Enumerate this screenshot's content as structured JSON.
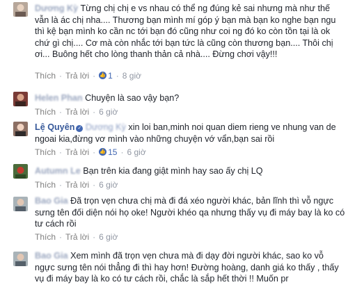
{
  "comments": [
    {
      "author": "Dương Kỳ",
      "text": "Từng chị chị e vs nhau có thể ng đúng kẻ sai nhưng mà như thế vẫn là ác chị nha.... Thương bạn mình mí góp ý bạn mà bạn ko nghe bạn ngu thì kệ bạn mình ko cần nc tới bạn đó cũng như coi ng đó ko còn tồn tại là ok chứ gì chị.... Cơ mà còn nhắc tới bạn tức là cũng còn thương bạn.... Thôi chị ơi... Buông hết cho lòng thanh thản cả nhà.... Đừng chơi vậy!!!",
      "like": "Thích",
      "reply": "Trả lời",
      "reactions": "1",
      "time": "8 giờ"
    },
    {
      "author": "Helen Phan",
      "text": "Chuyện là sao vậy bạn?",
      "like": "Thích",
      "reply": "Trả lời",
      "time": "6 giờ"
    },
    {
      "author": "Lệ Quyên",
      "mention": "Dương Kỳ",
      "text": "xin loi ban,minh noi quan diem rieng ve nhung van de ngoai kia,đừng vơ mình vào những chuyện vớ vẩn,bạn sai rồi",
      "like": "Thích",
      "reply": "Trả lời",
      "reactions": "15",
      "time": "6 giờ"
    },
    {
      "author": "Autumn Le",
      "text": "Bạn trên kia đang giật mình hay sao ấy chị LQ",
      "like": "Thích",
      "reply": "Trả lời",
      "time": "6 giờ"
    },
    {
      "author": "Bao Gia",
      "text": "Đã trọn vẹn chưa chị mà đi đá xéo người khác, bản lĩnh thì vỗ ngực sưng tên đối diện nói họ oke! Người khéo qa nhưng thấy vụ đi máy bay là ko có tư cách rồi",
      "like": "Thích",
      "reply": "Trả lời",
      "time": "6 giờ"
    },
    {
      "author": "Bao Gia",
      "text": "Xem mình đã trọn vẹn chưa mà đi dạy đời người khác, sao ko vỗ ngực sưng tên nói thẳng đi thì hay hơn! Đường hoàng, danh giá ko thấy , thấy vụ đi máy bay là ko có tư cách rồi, chắc là sắp hết thời !! Muốn pr"
    }
  ],
  "colors": {
    "link": "#365899",
    "meta": "#7f7f7f",
    "reaction": "#4267b2"
  }
}
